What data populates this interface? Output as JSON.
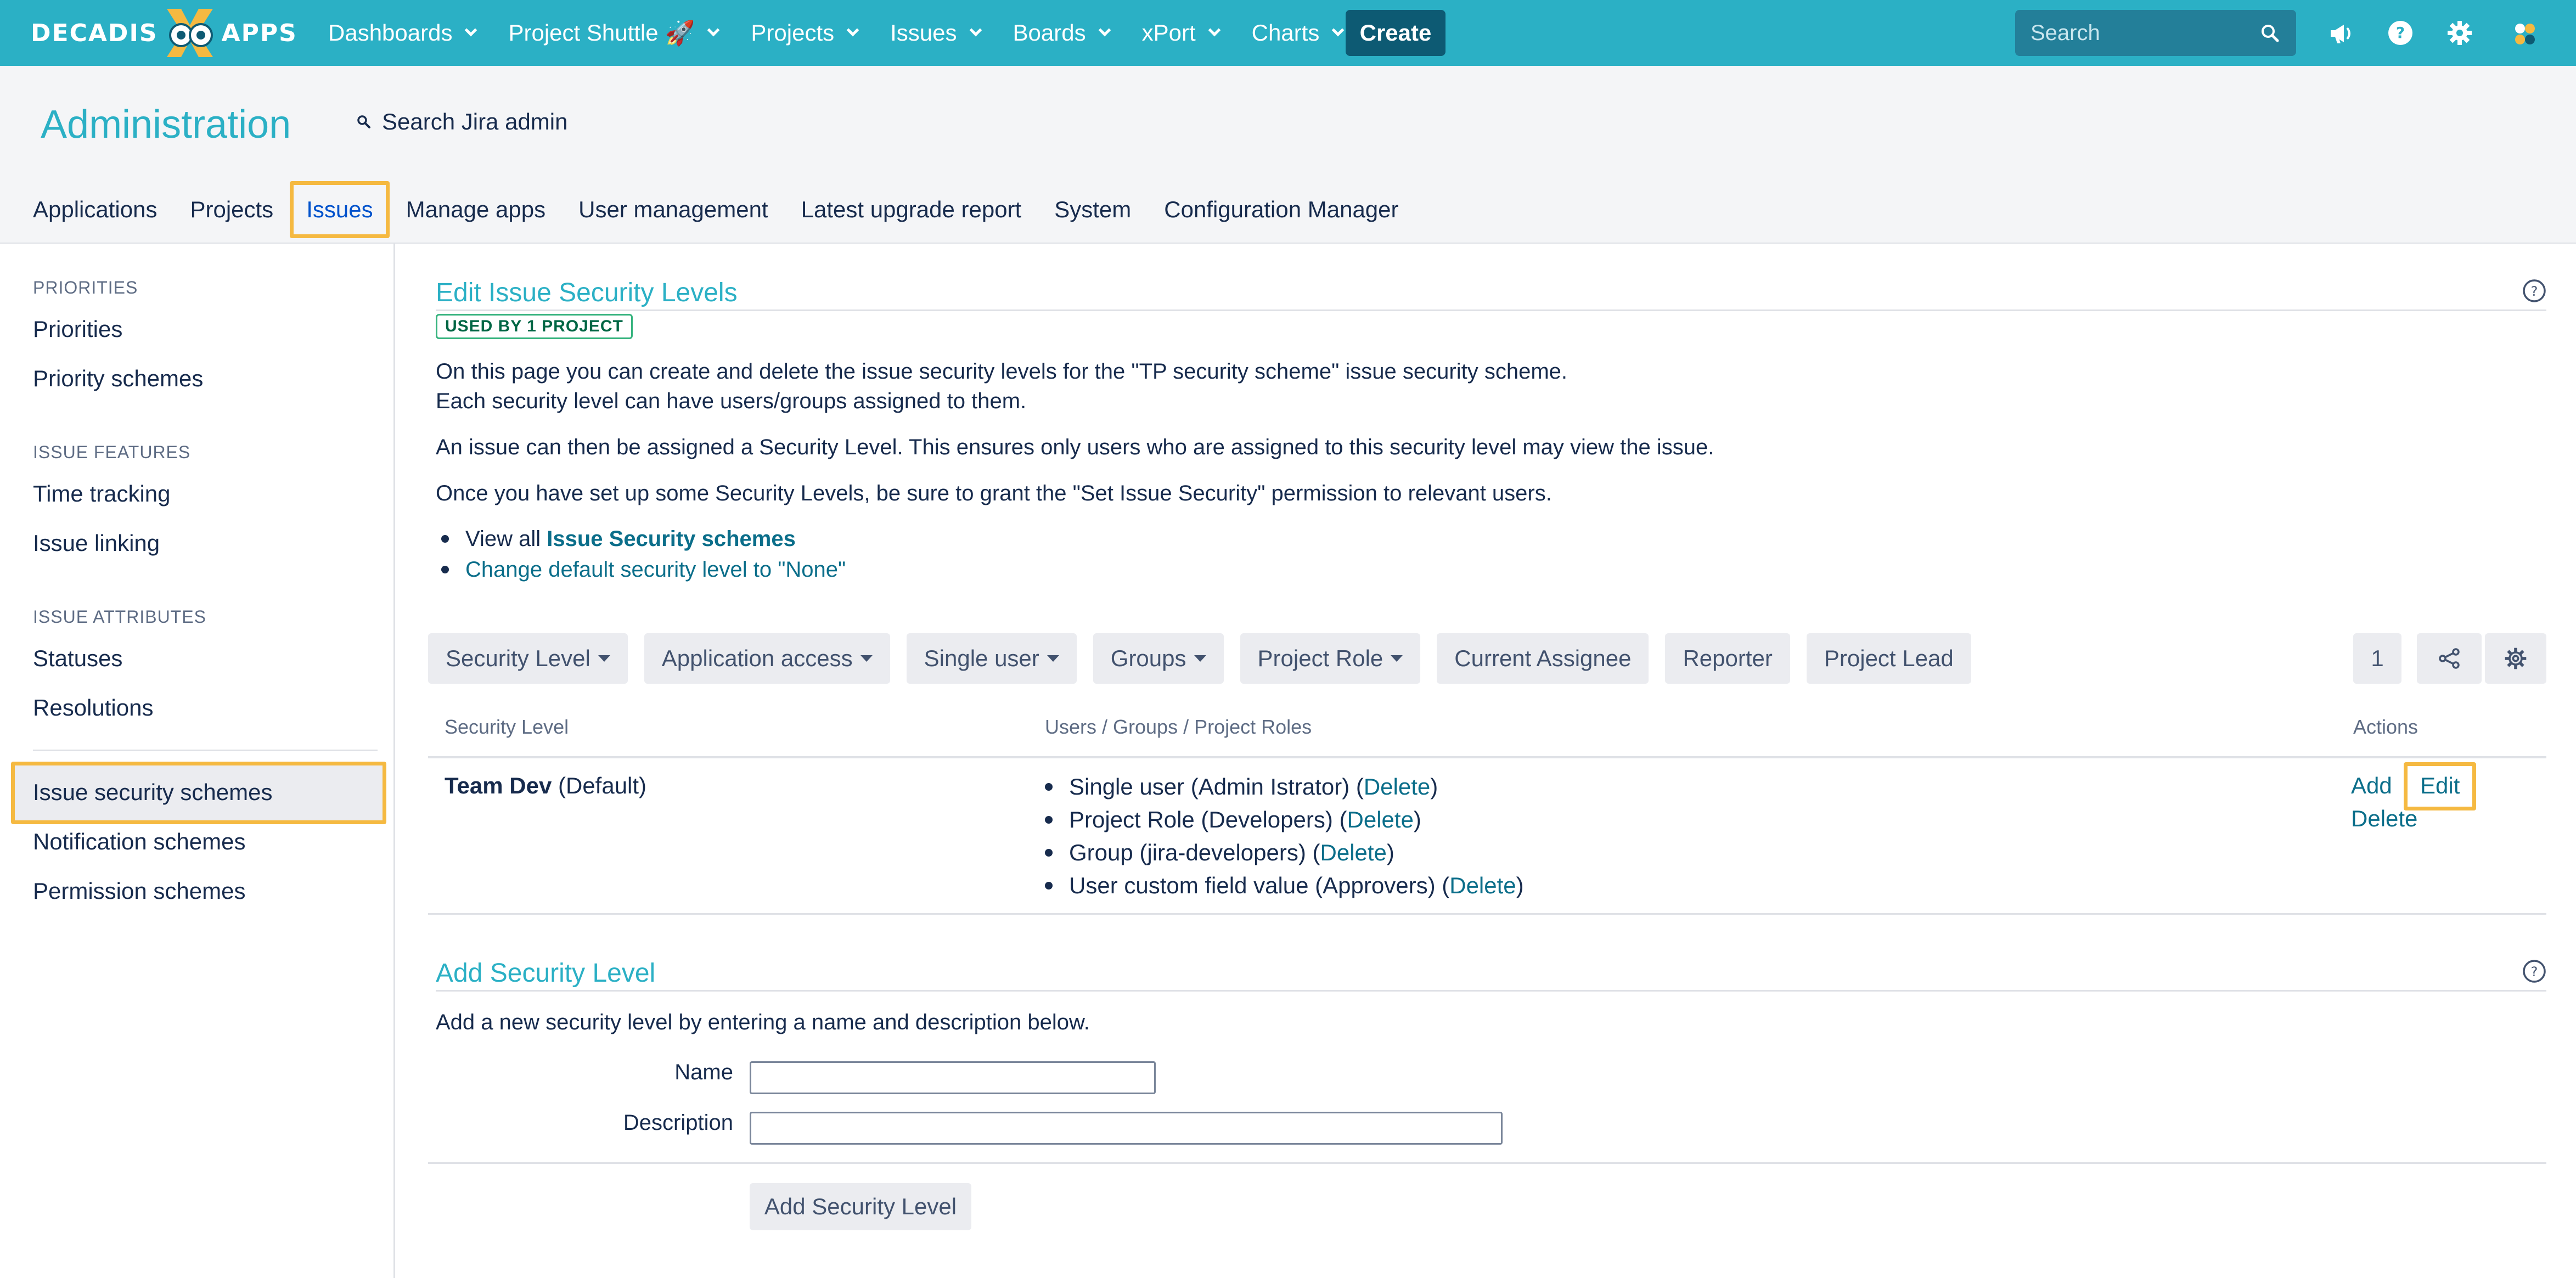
{
  "logo": {
    "left": "DECADIS",
    "right": "APPS"
  },
  "topnav": {
    "items": [
      {
        "label": "Dashboards"
      },
      {
        "label": "Project Shuttle",
        "emoji": "🚀"
      },
      {
        "label": "Projects"
      },
      {
        "label": "Issues"
      },
      {
        "label": "Boards"
      },
      {
        "label": "xPort"
      },
      {
        "label": "Charts"
      }
    ],
    "create_label": "Create",
    "search_placeholder": "Search"
  },
  "colors": {
    "brand": "#2bb0c5",
    "create": "#0d5a73",
    "highlight": "#f5b941",
    "link": "#0b6e8a"
  },
  "admin": {
    "title": "Administration",
    "search_label": "Search Jira admin",
    "tabs": [
      "Applications",
      "Projects",
      "Issues",
      "Manage apps",
      "User management",
      "Latest upgrade report",
      "System",
      "Configuration Manager"
    ],
    "active_tab": "Issues"
  },
  "sidebar": {
    "sections": [
      {
        "heading": "PRIORITIES",
        "items": [
          "Priorities",
          "Priority schemes"
        ]
      },
      {
        "heading": "ISSUE FEATURES",
        "items": [
          "Time tracking",
          "Issue linking"
        ]
      },
      {
        "heading": "ISSUE ATTRIBUTES",
        "items": [
          "Statuses",
          "Resolutions"
        ]
      },
      {
        "heading": "",
        "items": [
          "Issue security schemes",
          "Notification schemes",
          "Permission schemes"
        ]
      }
    ],
    "selected": "Issue security schemes"
  },
  "page": {
    "title": "Edit Issue Security Levels",
    "lozenge": "USED BY 1 PROJECT",
    "intro_1": "On this page you can create and delete the issue security levels for the \"TP security scheme\" issue security scheme.",
    "intro_2": "Each security level can have users/groups assigned to them.",
    "intro_3": "An issue can then be assigned a Security Level. This ensures only users who are assigned to this security level may view the issue.",
    "intro_4": "Once you have set up some Security Levels, be sure to grant the \"Set Issue Security\" permission to relevant users.",
    "bullet_1_prefix": "View all ",
    "bullet_1_link": "Issue Security schemes",
    "bullet_2_link": "Change default security level to \"None\""
  },
  "filters": {
    "buttons": [
      "Security Level",
      "Application access",
      "Single user",
      "Groups",
      "Project Role",
      "Current Assignee",
      "Reporter",
      "Project Lead"
    ],
    "count": "1"
  },
  "table": {
    "headers": [
      "Security Level",
      "Users / Groups / Project Roles",
      "Actions"
    ],
    "rows": [
      {
        "name": "Team Dev",
        "suffix": "(Default)",
        "entries": [
          {
            "text": "Single user (Admin Istrator) (",
            "link": "Delete",
            "close": ")"
          },
          {
            "text": "Project Role (Developers) (",
            "link": "Delete",
            "close": ")"
          },
          {
            "text": "Group (jira-developers) (",
            "link": "Delete",
            "close": ")"
          },
          {
            "text": "User custom field value (Approvers) (",
            "link": "Delete",
            "close": ")"
          }
        ],
        "actions": [
          "Add",
          "Edit",
          "Delete"
        ]
      }
    ]
  },
  "add_form": {
    "title": "Add Security Level",
    "description": "Add a new security level by entering a name and description below.",
    "name_label": "Name",
    "name_value": "",
    "desc_label": "Description",
    "desc_value": "",
    "submit_label": "Add Security Level"
  }
}
